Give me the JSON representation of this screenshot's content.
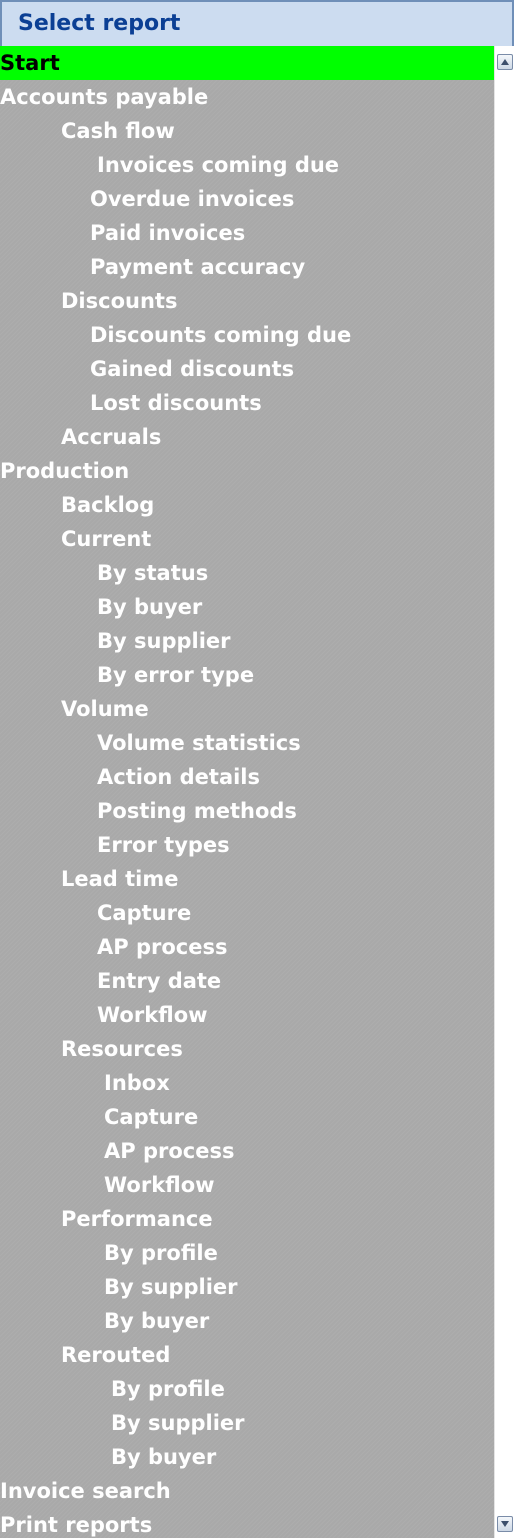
{
  "header": {
    "title": "Select report"
  },
  "report_tree": {
    "items": [
      {
        "label": "Start",
        "selected": true
      },
      {
        "label": "Accounts payable"
      },
      {
        "label": "Cash flow"
      },
      {
        "label": "Invoices coming due"
      },
      {
        "label": "Overdue invoices"
      },
      {
        "label": "Paid invoices"
      },
      {
        "label": "Payment accuracy"
      },
      {
        "label": "Discounts"
      },
      {
        "label": "Discounts coming due"
      },
      {
        "label": "Gained discounts"
      },
      {
        "label": "Lost discounts"
      },
      {
        "label": "Accruals"
      },
      {
        "label": "Production"
      },
      {
        "label": "Backlog"
      },
      {
        "label": "Current"
      },
      {
        "label": "By status"
      },
      {
        "label": "By buyer"
      },
      {
        "label": "By supplier"
      },
      {
        "label": "By error type"
      },
      {
        "label": "Volume"
      },
      {
        "label": "Volume statistics"
      },
      {
        "label": "Action details"
      },
      {
        "label": "Posting methods"
      },
      {
        "label": "Error types"
      },
      {
        "label": "Lead time"
      },
      {
        "label": "Capture"
      },
      {
        "label": "AP process"
      },
      {
        "label": "Entry date"
      },
      {
        "label": "Workflow"
      },
      {
        "label": "Resources"
      },
      {
        "label": "Inbox"
      },
      {
        "label": "Capture"
      },
      {
        "label": "AP process"
      },
      {
        "label": "Workflow"
      },
      {
        "label": "Performance"
      },
      {
        "label": "By profile"
      },
      {
        "label": "By supplier"
      },
      {
        "label": "By buyer"
      },
      {
        "label": "Rerouted"
      },
      {
        "label": "By profile"
      },
      {
        "label": "By supplier"
      },
      {
        "label": "By buyer"
      },
      {
        "label": "Invoice search"
      },
      {
        "label": "Print reports"
      }
    ]
  },
  "scrollbar": {
    "up_icon": "scroll-up-arrow-icon",
    "down_icon": "scroll-down-arrow-icon"
  },
  "colors": {
    "selected_background": "#00ff00",
    "list_background": "#a9a9a9",
    "header_background": "#ccdcf0",
    "header_text": "#0b3f94"
  }
}
